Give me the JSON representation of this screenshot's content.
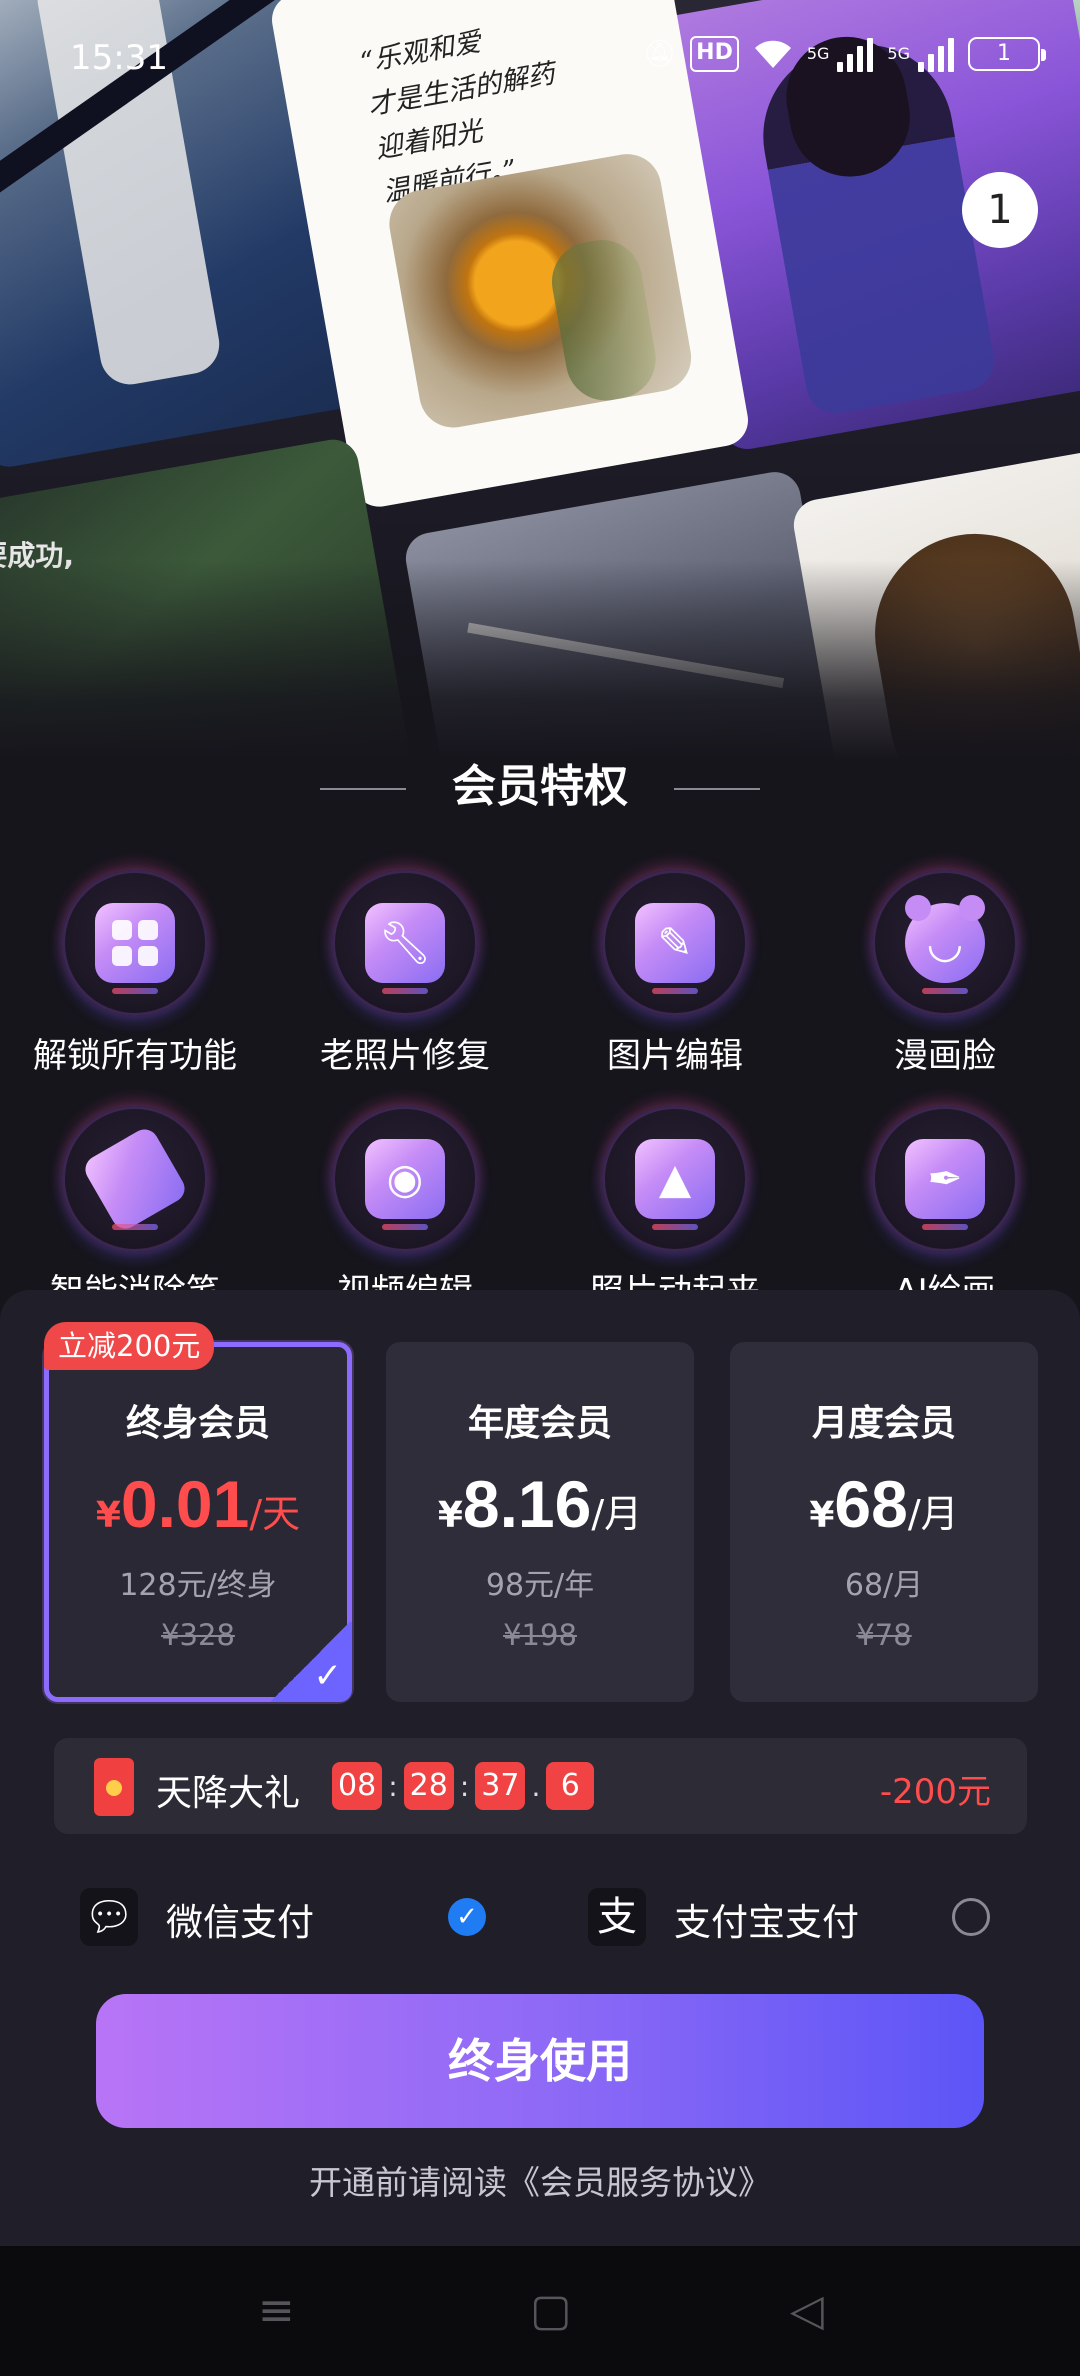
{
  "status_bar": {
    "time": "15:31",
    "hd_label": "HD",
    "network_1": "5G",
    "network_2": "5G",
    "battery": "1"
  },
  "hero": {
    "quote": "“乐观和爱\n才是生活的解药\n迎着阳光\n温暖前行。”",
    "tile_caption": "要成功,",
    "badge_count": "1"
  },
  "privileges": {
    "title": "会员特权",
    "items": [
      {
        "label": "解锁所有功能",
        "icon": "grid-apps-icon"
      },
      {
        "label": "老照片修复",
        "icon": "wrench-icon"
      },
      {
        "label": "图片编辑",
        "icon": "edit-image-icon"
      },
      {
        "label": "漫画脸",
        "icon": "bear-face-icon"
      },
      {
        "label": "智能消除笔",
        "icon": "eraser-icon"
      },
      {
        "label": "视频编辑",
        "icon": "video-camera-icon"
      },
      {
        "label": "照片动起来",
        "icon": "animate-photo-icon"
      },
      {
        "label": "AI绘画",
        "icon": "paint-brush-icon"
      }
    ]
  },
  "plans": {
    "ribbon": "立减200元",
    "options": [
      {
        "name": "终身会员",
        "currency": "¥",
        "price": "0.01",
        "unit": "/天",
        "sub": "128元/终身",
        "original": "¥328",
        "selected": true
      },
      {
        "name": "年度会员",
        "currency": "¥",
        "price": "8.16",
        "unit": "/月",
        "sub": "98元/年",
        "original": "¥198",
        "selected": false
      },
      {
        "name": "月度会员",
        "currency": "¥",
        "price": "68",
        "unit": "/月",
        "sub": "68/月",
        "original": "¥78",
        "selected": false
      }
    ]
  },
  "gift": {
    "title": "天降大礼",
    "timer": [
      "08",
      "28",
      "37",
      "6"
    ],
    "amount": "-200元"
  },
  "payment": {
    "wechat": {
      "label": "微信支付",
      "selected": true
    },
    "alipay": {
      "label": "支付宝支付",
      "selected": false
    }
  },
  "cta": {
    "label": "终身使用"
  },
  "agreement": "开通前请阅读《会员服务协议》",
  "colors": {
    "accent": "#8b6cff",
    "price_red": "#ff4d4d",
    "wechat_check": "#1f7cf3",
    "background": "#16151c"
  }
}
